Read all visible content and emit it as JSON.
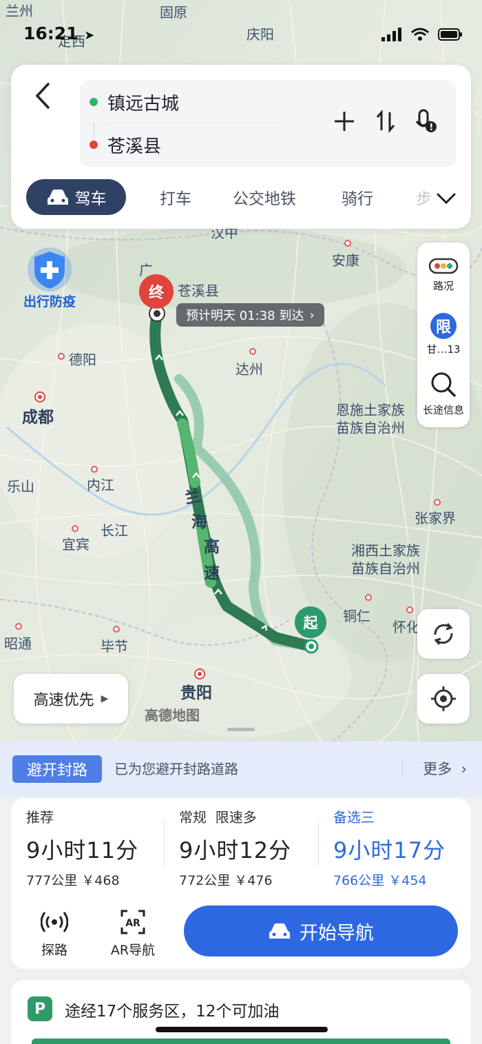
{
  "status": {
    "time": "16:21"
  },
  "search": {
    "origin": "镇远古城",
    "destination": "苍溪县"
  },
  "modes": {
    "active": "驾车",
    "taxi": "打车",
    "transit": "公交地铁",
    "cycle": "骑行",
    "more": "步"
  },
  "map": {
    "places": {
      "lanzhou": "兰州",
      "guyuan": "固原",
      "qingyang": "庆阳",
      "dingxi": "定西",
      "hanzhong": "汉中",
      "ankang": "安康",
      "guang": "广",
      "cangxi": "苍溪县",
      "deyang": "德阳",
      "chengdu": "成都",
      "dazhou": "达州",
      "enshi": "恩施土家族\n苗族自治州",
      "leshan": "乐山",
      "neijiang": "内江",
      "yibin": "宜宾",
      "changjiang": "长江",
      "zhangjiajie": "张家界",
      "xiangxi": "湘西土家族\n苗族自治州",
      "tongren": "铜仁",
      "huaihua": "怀化",
      "zhaotong": "昭通",
      "bijie": "毕节",
      "guiyang": "贵阳"
    },
    "road_name": [
      "兰",
      "海",
      "高",
      "速"
    ],
    "fangyi": "出行防疫",
    "eta": "预计明天 01:38 到达",
    "end_pin": "终",
    "start_pin": "起",
    "traffic_label": "路况",
    "restrict_icon": "限",
    "restrict_label": "甘…13",
    "longtrip_label": "长途信息",
    "route_pref": "高速优先",
    "logo": "高德地图"
  },
  "avoid": {
    "tag": "避开封路",
    "text": "已为您避开封路道路",
    "more": "更多"
  },
  "routes": [
    {
      "label": "推荐",
      "duration": "9小时11分",
      "meta": "777公里 ￥468",
      "selected": false
    },
    {
      "label": "常规  限速多",
      "duration": "9小时12分",
      "meta": "772公里 ￥476",
      "selected": false
    },
    {
      "label": "备选三",
      "duration": "9小时17分",
      "meta": "766公里 ￥454",
      "selected": true
    }
  ],
  "tools": {
    "explore": "探路",
    "ar": "AR导航"
  },
  "nav_button": "开始导航",
  "service": {
    "icon": "P",
    "text": "途经17个服务区，12个可加油"
  },
  "colors": {
    "route_main": "#2e7a52",
    "route_alt": "#8cc6a6",
    "accent": "#2e68e0",
    "end": "#e0443c",
    "start": "#2c9a6d"
  }
}
